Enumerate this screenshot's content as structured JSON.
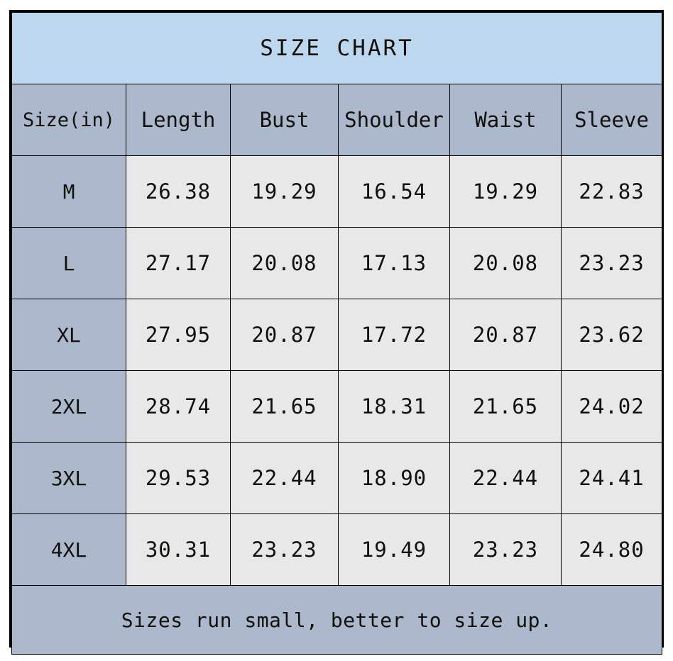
{
  "title": "SIZE CHART",
  "footer_note": "Sizes run small, better to size up.",
  "colors": {
    "title_band": "#bdd7ee",
    "header_band": "#acb9cc",
    "size_column": "#acb9cc",
    "value_cell": "#e8e8e8",
    "border": "#000000",
    "text": "#12100d",
    "page_background": "#ffffff"
  },
  "columns": [
    {
      "key": "size",
      "label": "Size(in)"
    },
    {
      "key": "length",
      "label": "Length"
    },
    {
      "key": "bust",
      "label": "Bust"
    },
    {
      "key": "shoulder",
      "label": "Shoulder"
    },
    {
      "key": "waist",
      "label": "Waist"
    },
    {
      "key": "sleeve",
      "label": "Sleeve"
    }
  ],
  "rows": [
    {
      "size": "M",
      "length": "26.38",
      "bust": "19.29",
      "shoulder": "16.54",
      "waist": "19.29",
      "sleeve": "22.83"
    },
    {
      "size": "L",
      "length": "27.17",
      "bust": "20.08",
      "shoulder": "17.13",
      "waist": "20.08",
      "sleeve": "23.23"
    },
    {
      "size": "XL",
      "length": "27.95",
      "bust": "20.87",
      "shoulder": "17.72",
      "waist": "20.87",
      "sleeve": "23.62"
    },
    {
      "size": "2XL",
      "length": "28.74",
      "bust": "21.65",
      "shoulder": "18.31",
      "waist": "21.65",
      "sleeve": "24.02"
    },
    {
      "size": "3XL",
      "length": "29.53",
      "bust": "22.44",
      "shoulder": "18.90",
      "waist": "22.44",
      "sleeve": "24.41"
    },
    {
      "size": "4XL",
      "length": "30.31",
      "bust": "23.23",
      "shoulder": "19.49",
      "waist": "23.23",
      "sleeve": "24.80"
    }
  ],
  "chart_data": {
    "type": "table",
    "title": "SIZE CHART",
    "unit": "in",
    "categories": [
      "M",
      "L",
      "XL",
      "2XL",
      "3XL",
      "4XL"
    ],
    "series": [
      {
        "name": "Length",
        "values": [
          26.38,
          27.17,
          27.95,
          28.74,
          29.53,
          30.31
        ]
      },
      {
        "name": "Bust",
        "values": [
          19.29,
          20.08,
          20.87,
          21.65,
          22.44,
          23.23
        ]
      },
      {
        "name": "Shoulder",
        "values": [
          16.54,
          17.13,
          17.72,
          18.31,
          18.9,
          19.49
        ]
      },
      {
        "name": "Waist",
        "values": [
          19.29,
          20.08,
          20.87,
          21.65,
          22.44,
          23.23
        ]
      },
      {
        "name": "Sleeve",
        "values": [
          22.83,
          23.23,
          23.62,
          24.02,
          24.41,
          24.8
        ]
      }
    ],
    "annotations": [
      "Sizes run small, better to size up."
    ]
  }
}
